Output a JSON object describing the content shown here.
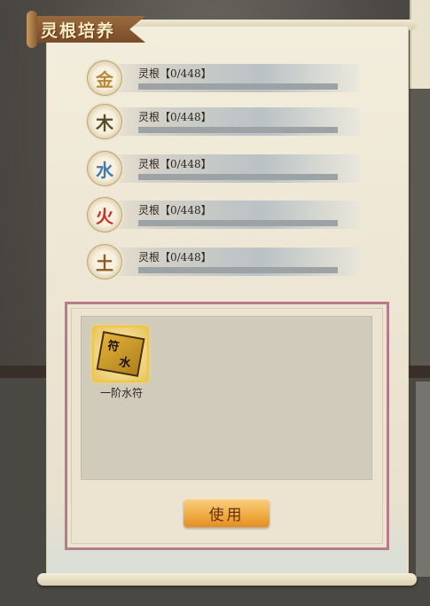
{
  "panel": {
    "title": "灵根培养"
  },
  "roots": [
    {
      "glyph": "金",
      "color": "#b7893a",
      "label": "灵根【0/448】",
      "progress": 0
    },
    {
      "glyph": "木",
      "color": "#5a4a2c",
      "label": "灵根【0/448】",
      "progress": 0
    },
    {
      "glyph": "水",
      "color": "#3f7ab0",
      "label": "灵根【0/448】",
      "progress": 0
    },
    {
      "glyph": "火",
      "color": "#c7332c",
      "label": "灵根【0/448】",
      "progress": 0
    },
    {
      "glyph": "土",
      "color": "#8a5a2b",
      "label": "灵根【0/448】",
      "progress": 0
    }
  ],
  "inventory": {
    "items": [
      {
        "name": "一阶水符",
        "icon": "water-talisman-icon"
      }
    ],
    "use_label": "使用"
  }
}
